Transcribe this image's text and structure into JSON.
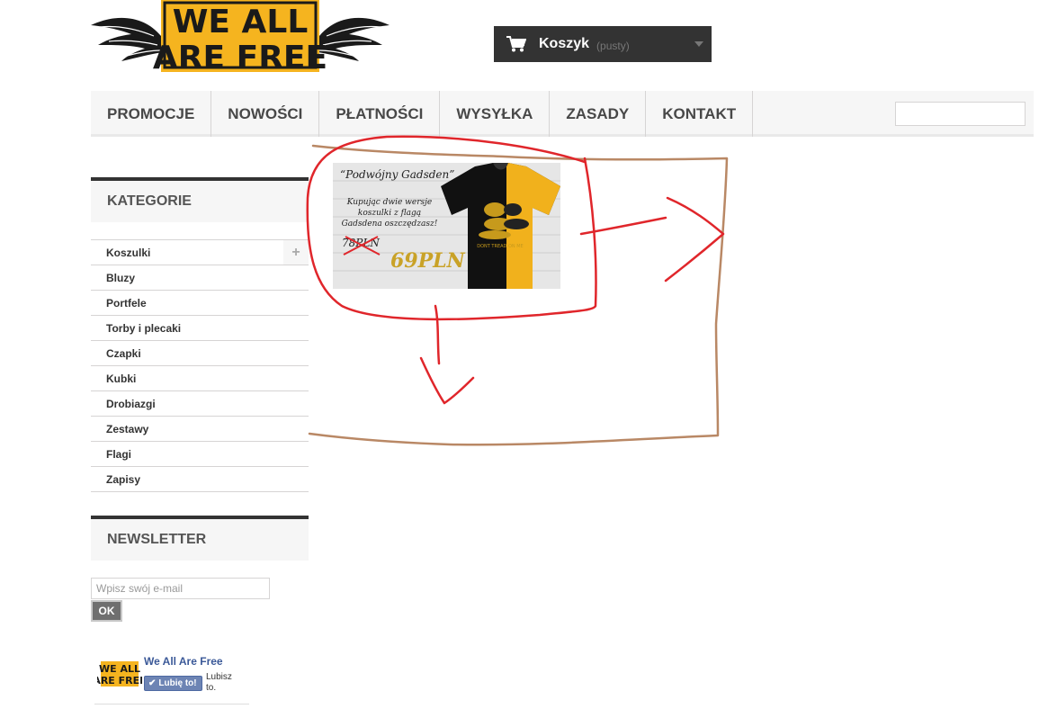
{
  "logo": {
    "alt": "WE ALL ARE FREE",
    "line1": "WE ALL",
    "line2": "ARE FREE"
  },
  "cart": {
    "label": "Koszyk",
    "status": "(pusty)",
    "icon": "cart-icon"
  },
  "menu": {
    "items": [
      "PROMOCJE",
      "NOWOŚCI",
      "PŁATNOŚCI",
      "WYSYŁKA",
      "ZASADY",
      "KONTAKT"
    ]
  },
  "sidebar": {
    "categories_title": "KATEGORIE",
    "categories": [
      "Koszulki",
      "Bluzy",
      "Portfele",
      "Torby i plecaki",
      "Czapki",
      "Kubki",
      "Drobiazgi",
      "Zestawy",
      "Flagi",
      "Zapisy"
    ],
    "expand_symbol": "+",
    "newsletter_title": "NEWSLETTER",
    "newsletter_placeholder": "Wpisz swój e-mail",
    "newsletter_button": "OK"
  },
  "facebook": {
    "page_name": "We All Are Free",
    "like_button": "Lubię to!",
    "like_status": "Lubisz to.",
    "logo_line1": "WE ALL",
    "logo_line2": "ARE FREE"
  },
  "banner": {
    "title": "“Podwójny Gadsden”",
    "description": "Kupując dwie wersje koszulki z flagą Gadsdena oszczędzasz!",
    "old_price": "78PLN",
    "new_price": "69PLN",
    "shirt_text": "DONT TREAD ON ME"
  },
  "colors": {
    "brand_yellow": "#f5b41f",
    "dark": "#333333",
    "annotation_red": "#e0262b",
    "annotation_brown": "#b98865"
  }
}
